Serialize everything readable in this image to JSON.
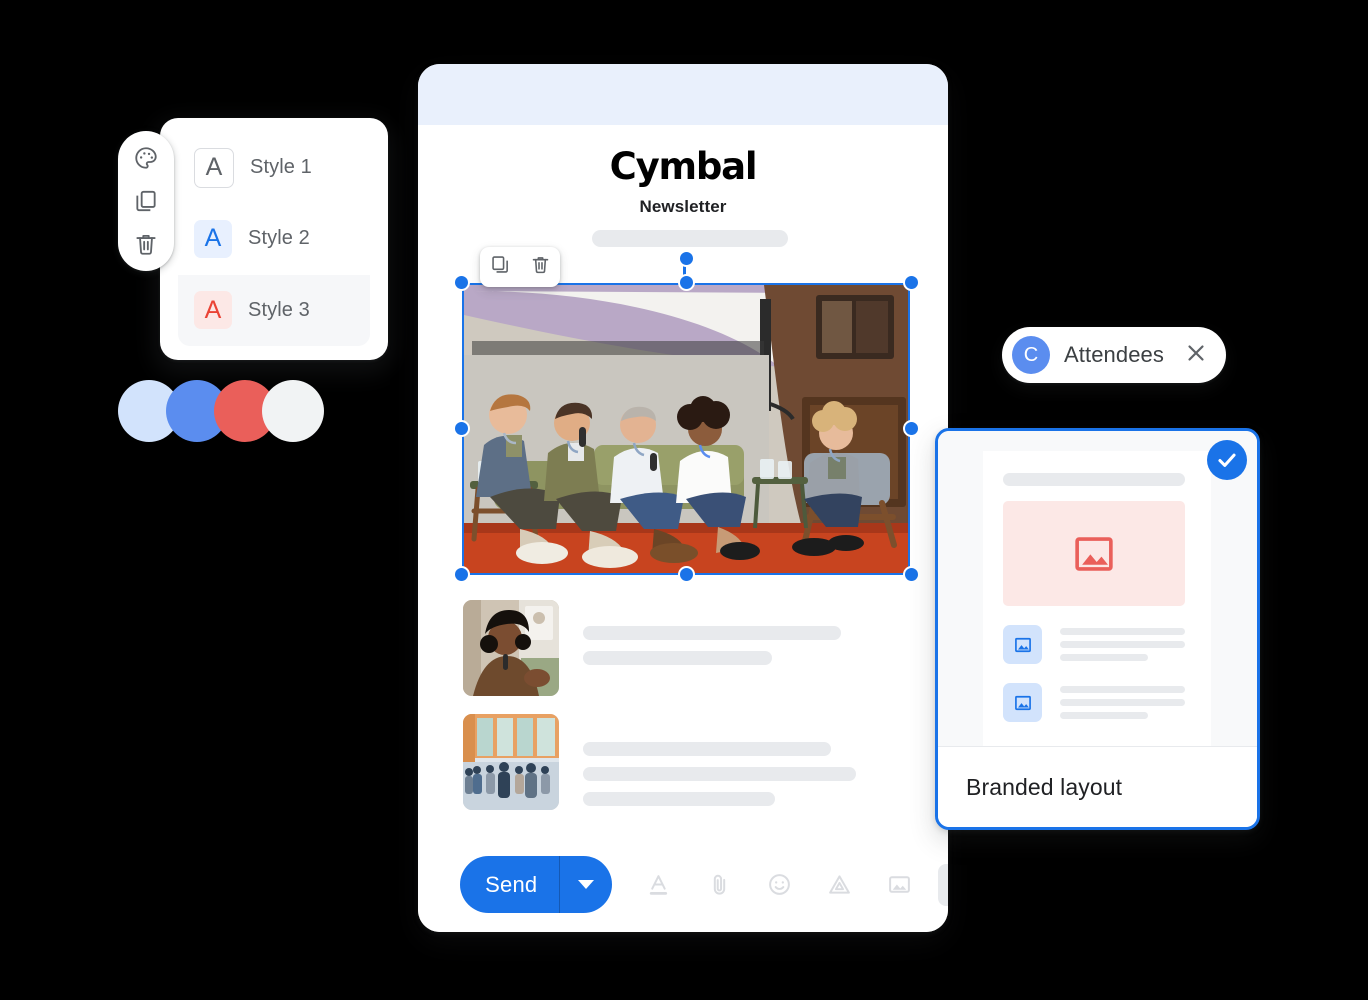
{
  "style_picker": {
    "tools": [
      {
        "name": "palette-icon",
        "label": "Color palette"
      },
      {
        "name": "duplicate-icon",
        "label": "Duplicate"
      },
      {
        "name": "delete-icon",
        "label": "Delete"
      }
    ],
    "styles": [
      {
        "label": "Style 1",
        "glyph": "A",
        "swatch_bg": "#ffffff",
        "glyph_color": "#5f6368",
        "selected": false
      },
      {
        "label": "Style 2",
        "glyph": "A",
        "swatch_bg": "#e8f0fe",
        "glyph_color": "#1a73e8",
        "selected": false
      },
      {
        "label": "Style 3",
        "glyph": "A",
        "swatch_bg": "#fce8e6",
        "glyph_color": "#ea4335",
        "selected": true
      }
    ]
  },
  "color_swatches": [
    {
      "name": "light-blue",
      "hex": "#d2e3fc"
    },
    {
      "name": "blue",
      "hex": "#5b8def"
    },
    {
      "name": "coral-red",
      "hex": "#ea5f5a"
    },
    {
      "name": "off-white",
      "hex": "#f1f3f4"
    }
  ],
  "email": {
    "header_band_color": "#e9f0fc",
    "brand_name": "Cymbal",
    "brand_subtitle": "Newsletter",
    "image_tools": [
      {
        "name": "duplicate-icon",
        "label": "Duplicate image"
      },
      {
        "name": "delete-icon",
        "label": "Delete image"
      }
    ],
    "hero_image_alt": "Panel discussion with five speakers seated on stage",
    "articles": [
      {
        "thumb_alt": "Woman speaking into a microphone",
        "line_widths": [
          258,
          189
        ]
      },
      {
        "thumb_alt": "Crowd of attendees networking in a hall",
        "line_widths": [
          248,
          273,
          192
        ]
      }
    ],
    "toolbar": {
      "send_label": "Send",
      "send_color": "#1a73e8",
      "dropdown_name": "send-options-caret",
      "icons": [
        {
          "name": "text-format-icon",
          "label": "Formatting options",
          "active": false
        },
        {
          "name": "attach-icon",
          "label": "Attach files",
          "active": false
        },
        {
          "name": "emoji-icon",
          "label": "Insert emoji",
          "active": false
        },
        {
          "name": "drive-icon",
          "label": "Insert files using Drive",
          "active": false
        },
        {
          "name": "insert-photo-icon",
          "label": "Insert photo",
          "active": false
        },
        {
          "name": "layout-icon",
          "label": "Insert layout",
          "active": true
        }
      ]
    }
  },
  "attendees_chip": {
    "avatar_initial": "C",
    "avatar_color": "#5b8def",
    "label": "Attendees",
    "close_icon": "close-icon"
  },
  "layout_card": {
    "name": "Branded layout",
    "selected": true,
    "check_icon": "check-icon",
    "hero_icon": "image-icon",
    "hero_bg": "#fce8e6",
    "hero_icon_color": "#ea5f5a",
    "row_icon": "image-icon",
    "row_bg": "#d2e3fc",
    "row_icon_color": "#1a73e8",
    "rows": [
      {
        "line_widths": [
          125,
          125,
          88
        ]
      },
      {
        "line_widths": [
          125,
          125,
          88
        ]
      }
    ]
  }
}
